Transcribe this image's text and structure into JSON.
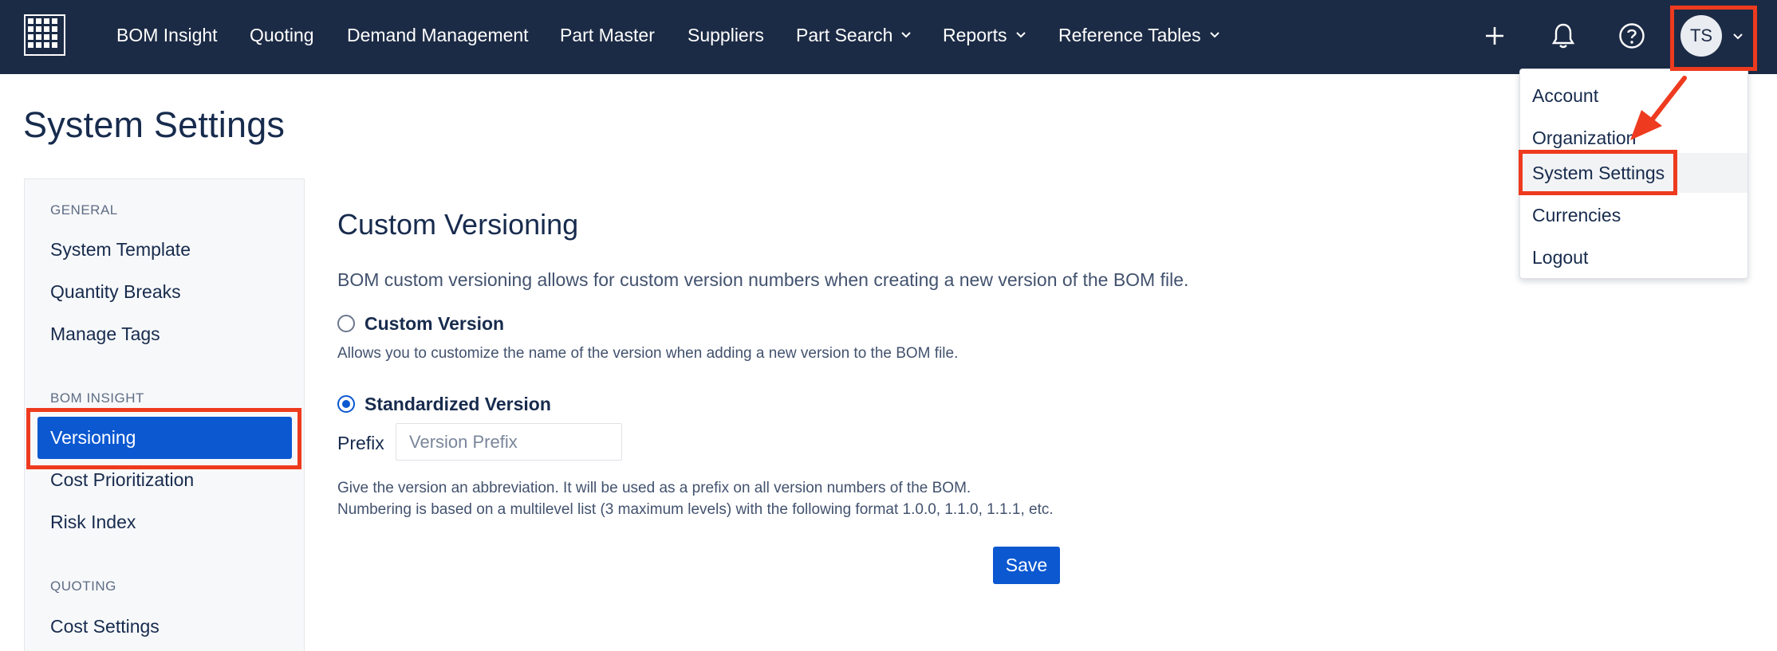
{
  "nav": {
    "logo_icon": "grid-logo-icon",
    "items": [
      {
        "label": "BOM Insight",
        "has_menu": false
      },
      {
        "label": "Quoting",
        "has_menu": false
      },
      {
        "label": "Demand Management",
        "has_menu": false
      },
      {
        "label": "Part Master",
        "has_menu": false
      },
      {
        "label": "Suppliers",
        "has_menu": false
      },
      {
        "label": "Part Search",
        "has_menu": true
      },
      {
        "label": "Reports",
        "has_menu": true
      },
      {
        "label": "Reference Tables",
        "has_menu": true
      }
    ],
    "icons": [
      "plus-icon",
      "bell-icon",
      "help-icon"
    ],
    "avatar_initials": "TS"
  },
  "page": {
    "title": "System Settings"
  },
  "sidebar": {
    "sections": [
      {
        "heading": "GENERAL",
        "items": [
          "System Template",
          "Quantity Breaks",
          "Manage Tags"
        ]
      },
      {
        "heading": "BOM INSIGHT",
        "items": [
          "Versioning",
          "Cost Prioritization",
          "Risk Index"
        ]
      },
      {
        "heading": "QUOTING",
        "items": [
          "Cost Settings"
        ]
      }
    ],
    "active_item": "Versioning"
  },
  "main": {
    "title": "Custom Versioning",
    "description": "BOM custom versioning allows for custom version numbers when creating a new version of the BOM file.",
    "options": [
      {
        "label": "Custom Version",
        "helper": "Allows you to customize the name of the version when adding a new version to the BOM file.",
        "selected": false
      },
      {
        "label": "Standardized Version",
        "selected": true
      }
    ],
    "prefix": {
      "label": "Prefix",
      "placeholder": "Version Prefix",
      "value": ""
    },
    "help_lines": [
      "Give the version an abbreviation. It will be used as a prefix on all version numbers of the BOM.",
      "Numbering is based on a multilevel list (3 maximum levels) with the following format 1.0.0, 1.1.0, 1.1.1, etc."
    ],
    "save_label": "Save"
  },
  "user_menu": {
    "items": [
      "Account",
      "Organization",
      "System Settings",
      "Currencies",
      "Logout"
    ],
    "highlighted": "System Settings"
  },
  "colors": {
    "nav_bg": "#1c2b45",
    "accent": "#0b58d1",
    "annotation": "#ee3b1f"
  }
}
